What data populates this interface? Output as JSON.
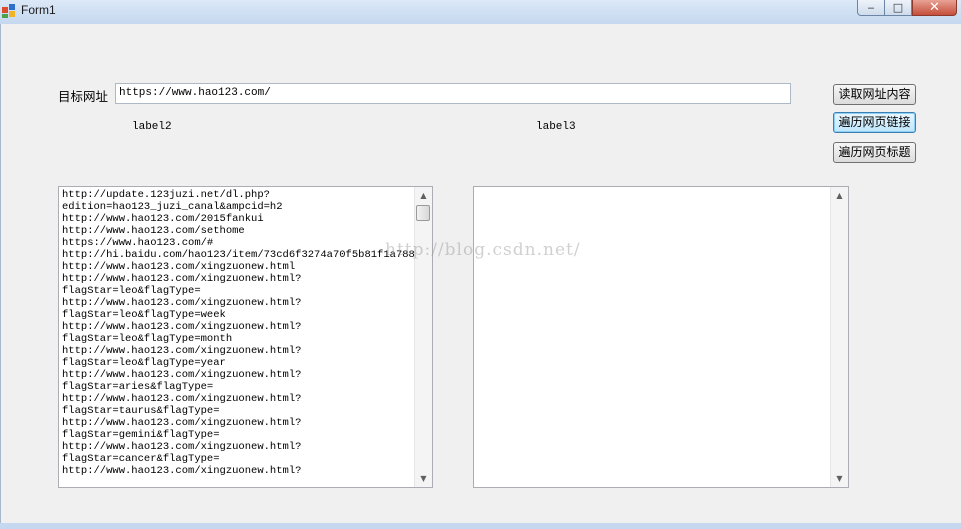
{
  "window": {
    "title": "Form1",
    "min_glyph": "‒",
    "max_glyph": "□",
    "close_glyph": "✕"
  },
  "form": {
    "url_label": "目标网址",
    "url_value": "https://www.hao123.com/",
    "label2": "label2",
    "label3": "label3",
    "buttons": {
      "read": "读取网址内容",
      "links": "遍历网页链接",
      "titles": "遍历网页标题"
    },
    "links_text": "http://update.123juzi.net/dl.php?\nedition=hao123_juzi_canal&ampcid=h2\nhttp://www.hao123.com/2015fankui\nhttp://www.hao123.com/sethome\nhttps://www.hao123.com/#\nhttp://hi.baidu.com/hao123/item/73cd6f3274a70f5b81f1a788\nhttp://www.hao123.com/xingzuonew.html\nhttp://www.hao123.com/xingzuonew.html?\nflagStar=leo&flagType=\nhttp://www.hao123.com/xingzuonew.html?\nflagStar=leo&flagType=week\nhttp://www.hao123.com/xingzuonew.html?\nflagStar=leo&flagType=month\nhttp://www.hao123.com/xingzuonew.html?\nflagStar=leo&flagType=year\nhttp://www.hao123.com/xingzuonew.html?\nflagStar=aries&flagType=\nhttp://www.hao123.com/xingzuonew.html?\nflagStar=taurus&flagType=\nhttp://www.hao123.com/xingzuonew.html?\nflagStar=gemini&flagType=\nhttp://www.hao123.com/xingzuonew.html?\nflagStar=cancer&flagType=\nhttp://www.hao123.com/xingzuonew.html?",
    "titles_text": ""
  },
  "scroll_arrows": {
    "up": "▲",
    "down": "▼"
  },
  "watermark": "http://blog.csdn.net/",
  "colors": {
    "focus_border": "#3c7fb1",
    "title_bar": "#c5d8ef",
    "client": "#f0f0f0"
  }
}
